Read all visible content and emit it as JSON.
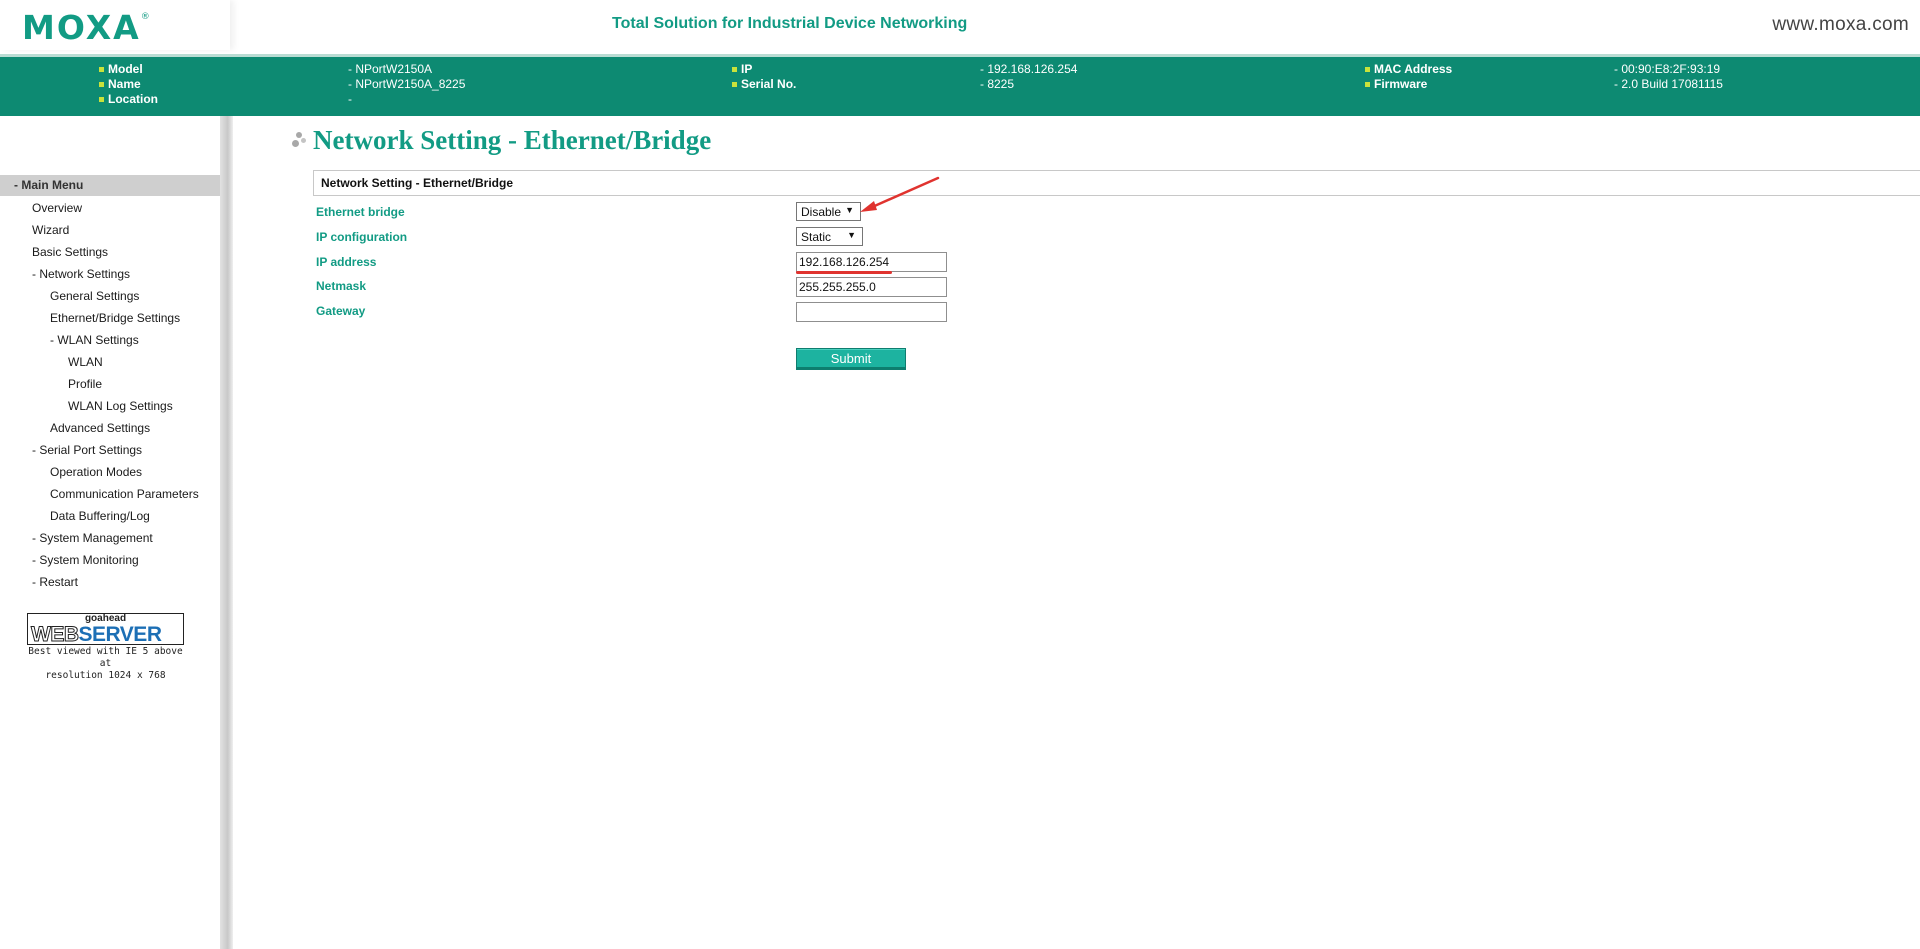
{
  "header": {
    "logo_text": "MOXA",
    "logo_mark": "®",
    "tagline": "Total Solution for Industrial Device Networking",
    "site_url": "www.moxa.com"
  },
  "device_info": {
    "model": {
      "label": "Model",
      "value": "- NPortW2150A"
    },
    "name": {
      "label": "Name",
      "value": "- NPortW2150A_8225"
    },
    "location": {
      "label": "Location",
      "value": "-"
    },
    "ip": {
      "label": "IP",
      "value": "- 192.168.126.254"
    },
    "serial": {
      "label": "Serial No.",
      "value": "- 8225"
    },
    "mac": {
      "label": "MAC Address",
      "value": "- 00:90:E8:2F:93:19"
    },
    "firmware": {
      "label": "Firmware",
      "value": "- 2.0 Build 17081115"
    }
  },
  "sidebar": {
    "main_menu": "- Main Menu",
    "items": [
      {
        "label": "Overview"
      },
      {
        "label": "Wizard"
      },
      {
        "label": "Basic Settings"
      },
      {
        "label": "- Network Settings"
      },
      {
        "label": "General Settings"
      },
      {
        "label": "Ethernet/Bridge Settings"
      },
      {
        "label": "- WLAN Settings"
      },
      {
        "label": "WLAN"
      },
      {
        "label": "Profile"
      },
      {
        "label": "WLAN Log Settings"
      },
      {
        "label": "Advanced Settings"
      },
      {
        "label": "- Serial Port Settings"
      },
      {
        "label": "Operation Modes"
      },
      {
        "label": "Communication Parameters"
      },
      {
        "label": "Data Buffering/Log"
      },
      {
        "label": "- System Management"
      },
      {
        "label": "- System Monitoring"
      },
      {
        "label": "- Restart"
      }
    ],
    "badge": {
      "top": "goahead",
      "web": "WEB",
      "server": "SERVER",
      "note_line1": "Best viewed with IE 5 above at",
      "note_line2": "resolution 1024 x 768"
    }
  },
  "main": {
    "page_title": "Network Setting - Ethernet/Bridge",
    "section_title": "Network Setting - Ethernet/Bridge",
    "fields": {
      "ethernet_bridge": {
        "label": "Ethernet bridge",
        "value": "Disable"
      },
      "ip_configuration": {
        "label": "IP configuration",
        "value": "Static"
      },
      "ip_address": {
        "label": "IP address",
        "value": "192.168.126.254"
      },
      "netmask": {
        "label": "Netmask",
        "value": "255.255.255.0"
      },
      "gateway": {
        "label": "Gateway",
        "value": ""
      }
    },
    "submit_label": "Submit"
  },
  "colors": {
    "brand_teal": "#129b84",
    "info_band": "#0d8a72",
    "bullet": "#c9e23b",
    "annotation_red": "#e0332f",
    "submit": "#1db3a0"
  }
}
